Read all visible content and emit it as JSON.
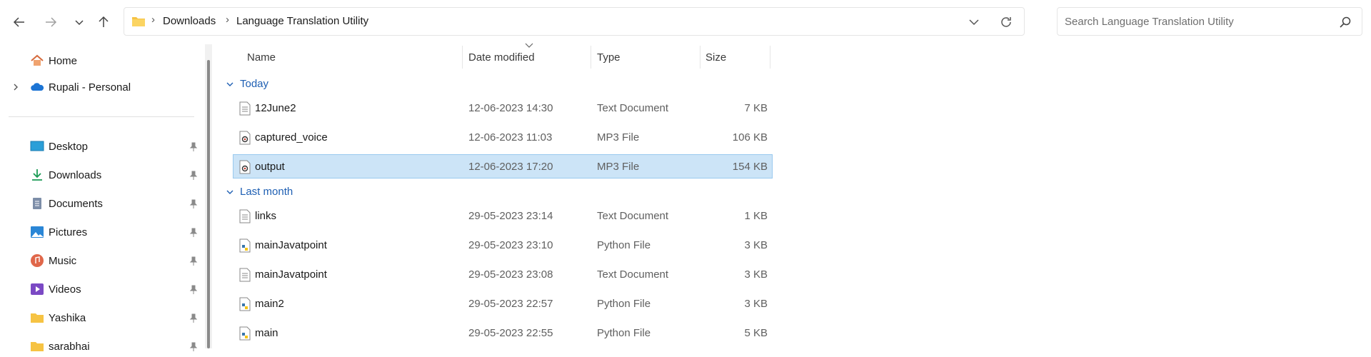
{
  "address": {
    "breadcrumbs": [
      "Downloads",
      "Language Translation Utility"
    ]
  },
  "search": {
    "placeholder": "Search Language Translation Utility"
  },
  "sidebar": {
    "items": [
      {
        "label": "Home",
        "icon": "home-icon"
      },
      {
        "label": "Rupali - Personal",
        "icon": "onedrive-icon"
      },
      {
        "label": "Desktop",
        "icon": "desktop-icon"
      },
      {
        "label": "Downloads",
        "icon": "downloads-icon"
      },
      {
        "label": "Documents",
        "icon": "documents-icon"
      },
      {
        "label": "Pictures",
        "icon": "pictures-icon"
      },
      {
        "label": "Music",
        "icon": "music-icon"
      },
      {
        "label": "Videos",
        "icon": "videos-icon"
      },
      {
        "label": "Yashika",
        "icon": "folder-icon"
      },
      {
        "label": "sarabhai",
        "icon": "folder-icon"
      }
    ]
  },
  "columns": {
    "name": "Name",
    "date": "Date modified",
    "type": "Type",
    "size": "Size"
  },
  "groups": [
    {
      "label": "Today",
      "files": [
        {
          "name": "12June2",
          "date": "12-06-2023 14:30",
          "type": "Text Document",
          "size": "7 KB",
          "icon": "text-file-icon"
        },
        {
          "name": "captured_voice",
          "date": "12-06-2023 11:03",
          "type": "MP3 File",
          "size": "106 KB",
          "icon": "audio-file-icon"
        },
        {
          "name": "output",
          "date": "12-06-2023 17:20",
          "type": "MP3 File",
          "size": "154 KB",
          "icon": "audio-file-icon",
          "selected": true
        }
      ]
    },
    {
      "label": "Last month",
      "files": [
        {
          "name": "links",
          "date": "29-05-2023 23:14",
          "type": "Text Document",
          "size": "1 KB",
          "icon": "text-file-icon"
        },
        {
          "name": "mainJavatpoint",
          "date": "29-05-2023 23:10",
          "type": "Python File",
          "size": "3 KB",
          "icon": "python-file-icon"
        },
        {
          "name": "mainJavatpoint",
          "date": "29-05-2023 23:08",
          "type": "Text Document",
          "size": "3 KB",
          "icon": "text-file-icon"
        },
        {
          "name": "main2",
          "date": "29-05-2023 22:57",
          "type": "Python File",
          "size": "3 KB",
          "icon": "python-file-icon"
        },
        {
          "name": "main",
          "date": "29-05-2023 22:55",
          "type": "Python File",
          "size": "5 KB",
          "icon": "python-file-icon"
        }
      ]
    }
  ],
  "colors": {
    "accent": "#1e5fb3",
    "selection": "#cce4f7",
    "selection_border": "#99c9ef"
  }
}
